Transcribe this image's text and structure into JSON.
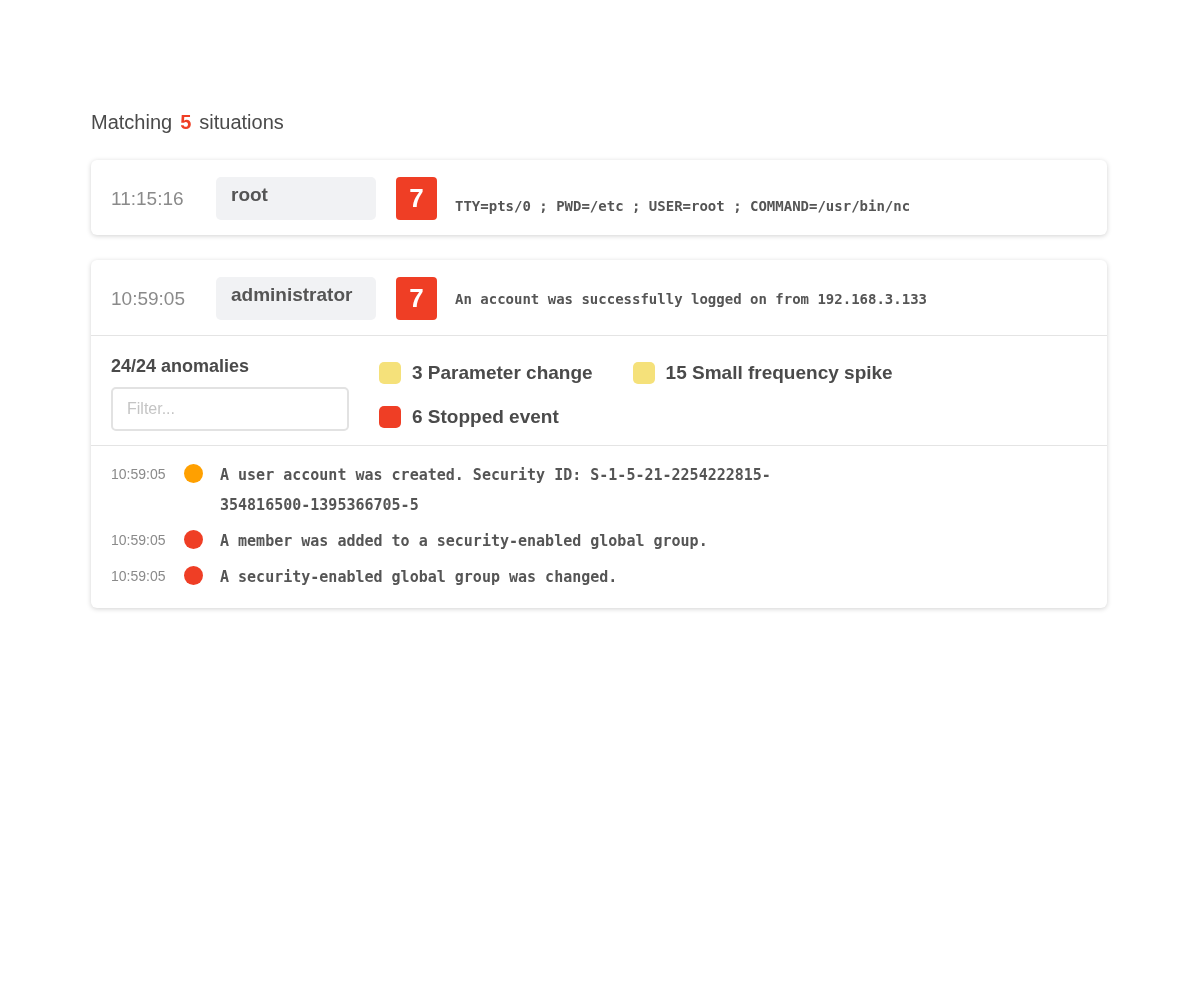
{
  "header": {
    "prefix": "Matching",
    "count": "5",
    "suffix": "situations"
  },
  "situations": [
    {
      "time": "11:15:16",
      "user": "root",
      "severity": "7",
      "message": "TTY=pts/0 ; PWD=/etc ; USER=root ; COMMAND=/usr/bin/nc",
      "expanded": false
    },
    {
      "time": "10:59:05",
      "user": "administrator",
      "severity": "7",
      "message": "An account was successfully logged on from 192.168.3.133",
      "expanded": true,
      "details": {
        "anomaly_count": "24/24 anomalies",
        "filter": {
          "placeholder": "Filter..."
        },
        "legend": [
          {
            "label": "3 Parameter change",
            "color": "#f5e17a"
          },
          {
            "label": "15 Small frequency spike",
            "color": "#f5e17a"
          },
          {
            "label": "6 Stopped event",
            "color": "#ef3e25"
          }
        ],
        "events": [
          {
            "time": "10:59:05",
            "color": "#ffa000",
            "message": "A user account was created. Security ID: S-1-5-21-2254222815-354816500-1395366705-5"
          },
          {
            "time": "10:59:05",
            "color": "#ef3e25",
            "message": "A member was added to a security-enabled global group."
          },
          {
            "time": "10:59:05",
            "color": "#ef3e25",
            "message": "A security-enabled global group was changed."
          }
        ]
      }
    }
  ]
}
